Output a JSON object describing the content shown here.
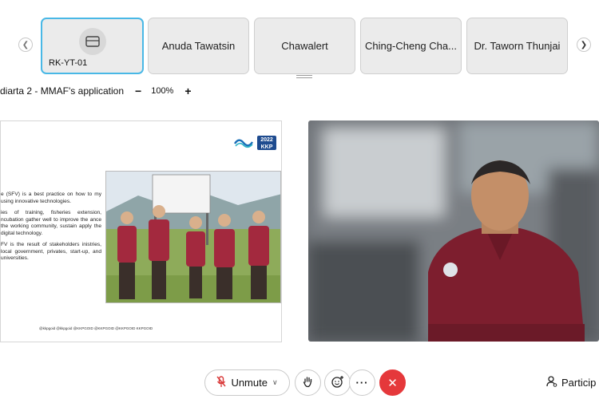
{
  "participants_strip": {
    "self_tile": {
      "name": "RK-YT-01"
    },
    "tiles": [
      {
        "name": "Anuda Tawatsin"
      },
      {
        "name": "Chawalert"
      },
      {
        "name": "Ching-Cheng Cha..."
      },
      {
        "name": "Dr. Taworn Thunjai"
      }
    ]
  },
  "share_bar": {
    "title": "diarta 2 - MMAF's application",
    "zoom_out_label": "−",
    "zoom_level": "100%",
    "zoom_in_label": "+"
  },
  "slide": {
    "badge_text": "2022 KKP",
    "paragraphs": [
      "e (SFV) is a best practice on how to my using innovative technologies.",
      "ies of training, fisheries extension, ncubation gather well to improve the ance the working community, sustain apply the digital technology.",
      "FV is the result of stakeholders inistries, local government, privates, start-up, and universities."
    ],
    "footer": "@kkpgoid  @kkpgoid  @KKPGOID  @KKPGOID  @KKPGOID  KKPGOID"
  },
  "controls": {
    "unmute_label": "Unmute",
    "participants_label": "Particip"
  }
}
